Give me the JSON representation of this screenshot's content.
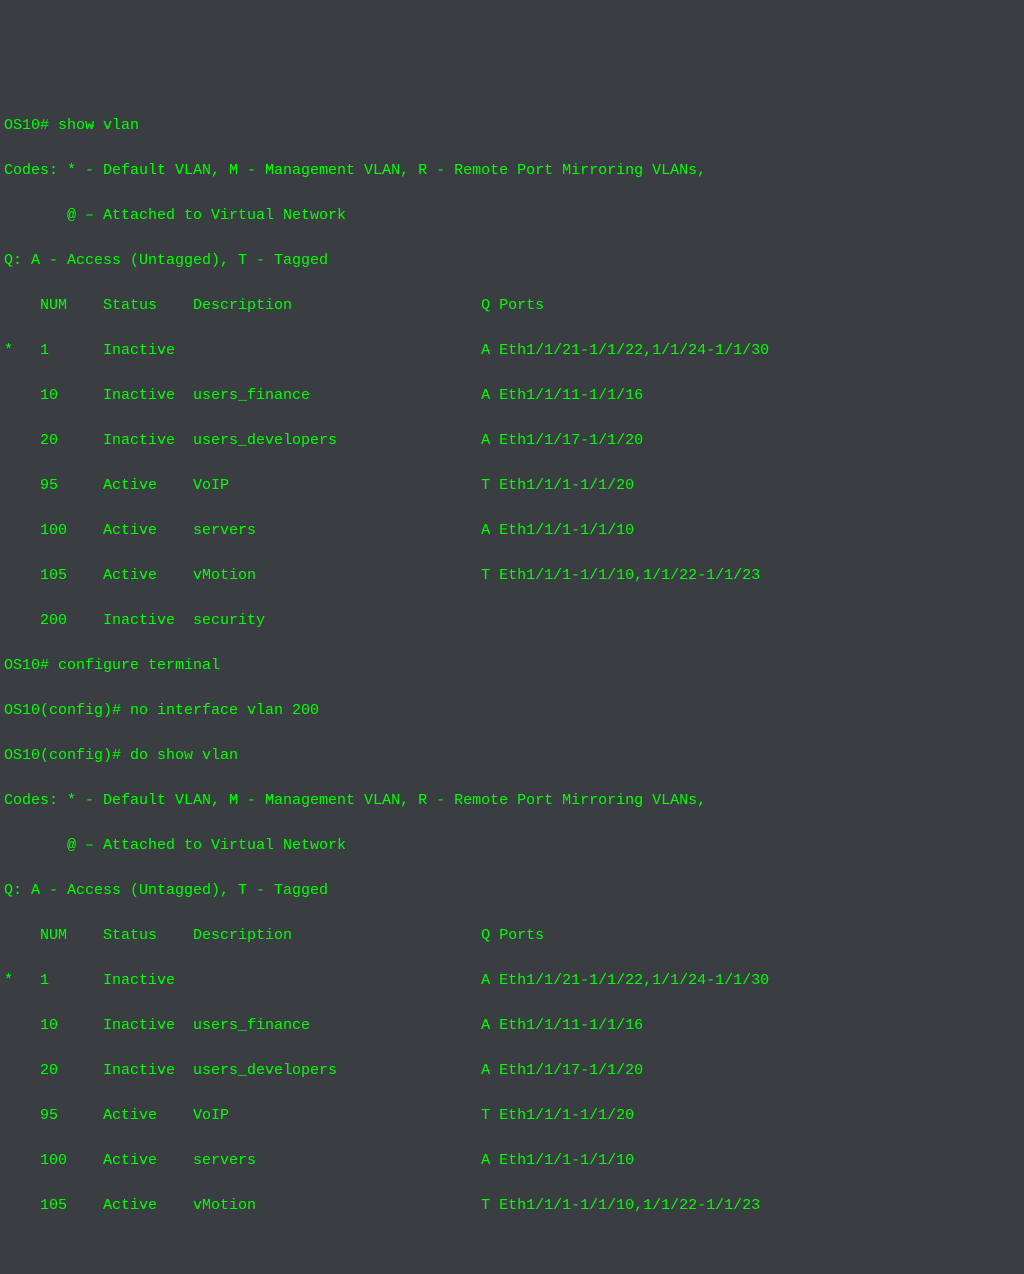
{
  "colors": {
    "bg": "#3a3e42",
    "fg": "#00ff00"
  },
  "block1": {
    "prompt_line": "OS10# show vlan",
    "codes_line1": "Codes: * - Default VLAN, M - Management VLAN, R - Remote Port Mirroring VLANs,",
    "codes_line2": "       @ – Attached to Virtual Network",
    "q_line": "Q: A - Access (Untagged), T - Tagged",
    "header": "    NUM    Status    Description                     Q Ports",
    "rows": [
      "*   1      Inactive                                  A Eth1/1/21-1/1/22,1/1/24-1/1/30",
      "    10     Inactive  users_finance                   A Eth1/1/11-1/1/16",
      "    20     Inactive  users_developers                A Eth1/1/17-1/1/20",
      "    95     Active    VoIP                            T Eth1/1/1-1/1/20",
      "    100    Active    servers                         A Eth1/1/1-1/1/10",
      "    105    Active    vMotion                         T Eth1/1/1-1/1/10,1/1/22-1/1/23",
      "    200    Inactive  security"
    ]
  },
  "cmd2": "OS10# configure terminal",
  "cmd3": "OS10(config)# no interface vlan 200",
  "cmd4": "OS10(config)# do show vlan",
  "block2": {
    "codes_line1": "Codes: * - Default VLAN, M - Management VLAN, R - Remote Port Mirroring VLANs,",
    "codes_line2": "       @ – Attached to Virtual Network",
    "q_line": "Q: A - Access (Untagged), T - Tagged",
    "header": "    NUM    Status    Description                     Q Ports",
    "rows": [
      "*   1      Inactive                                  A Eth1/1/21-1/1/22,1/1/24-1/1/30",
      "    10     Inactive  users_finance                   A Eth1/1/11-1/1/16",
      "    20     Inactive  users_developers                A Eth1/1/17-1/1/20",
      "    95     Active    VoIP                            T Eth1/1/1-1/1/20",
      "    100    Active    servers                         A Eth1/1/1-1/1/10",
      "    105    Active    vMotion                         T Eth1/1/1-1/1/10,1/1/22-1/1/23"
    ]
  },
  "chart_data": {
    "type": "table",
    "title": "VLAN configuration before and after removing VLAN 200",
    "before": [
      {
        "marker": "*",
        "num": 1,
        "status": "Inactive",
        "description": "",
        "q": "A",
        "ports": "Eth1/1/21-1/1/22,1/1/24-1/1/30"
      },
      {
        "marker": "",
        "num": 10,
        "status": "Inactive",
        "description": "users_finance",
        "q": "A",
        "ports": "Eth1/1/11-1/1/16"
      },
      {
        "marker": "",
        "num": 20,
        "status": "Inactive",
        "description": "users_developers",
        "q": "A",
        "ports": "Eth1/1/17-1/1/20"
      },
      {
        "marker": "",
        "num": 95,
        "status": "Active",
        "description": "VoIP",
        "q": "T",
        "ports": "Eth1/1/1-1/1/20"
      },
      {
        "marker": "",
        "num": 100,
        "status": "Active",
        "description": "servers",
        "q": "A",
        "ports": "Eth1/1/1-1/1/10"
      },
      {
        "marker": "",
        "num": 105,
        "status": "Active",
        "description": "vMotion",
        "q": "T",
        "ports": "Eth1/1/1-1/1/10,1/1/22-1/1/23"
      },
      {
        "marker": "",
        "num": 200,
        "status": "Inactive",
        "description": "security",
        "q": "",
        "ports": ""
      }
    ],
    "after": [
      {
        "marker": "*",
        "num": 1,
        "status": "Inactive",
        "description": "",
        "q": "A",
        "ports": "Eth1/1/21-1/1/22,1/1/24-1/1/30"
      },
      {
        "marker": "",
        "num": 10,
        "status": "Inactive",
        "description": "users_finance",
        "q": "A",
        "ports": "Eth1/1/11-1/1/16"
      },
      {
        "marker": "",
        "num": 20,
        "status": "Inactive",
        "description": "users_developers",
        "q": "A",
        "ports": "Eth1/1/17-1/1/20"
      },
      {
        "marker": "",
        "num": 95,
        "status": "Active",
        "description": "VoIP",
        "q": "T",
        "ports": "Eth1/1/1-1/1/20"
      },
      {
        "marker": "",
        "num": 100,
        "status": "Active",
        "description": "servers",
        "q": "A",
        "ports": "Eth1/1/1-1/1/10"
      },
      {
        "marker": "",
        "num": 105,
        "status": "Active",
        "description": "vMotion",
        "q": "T",
        "ports": "Eth1/1/1-1/1/10,1/1/22-1/1/23"
      }
    ]
  }
}
